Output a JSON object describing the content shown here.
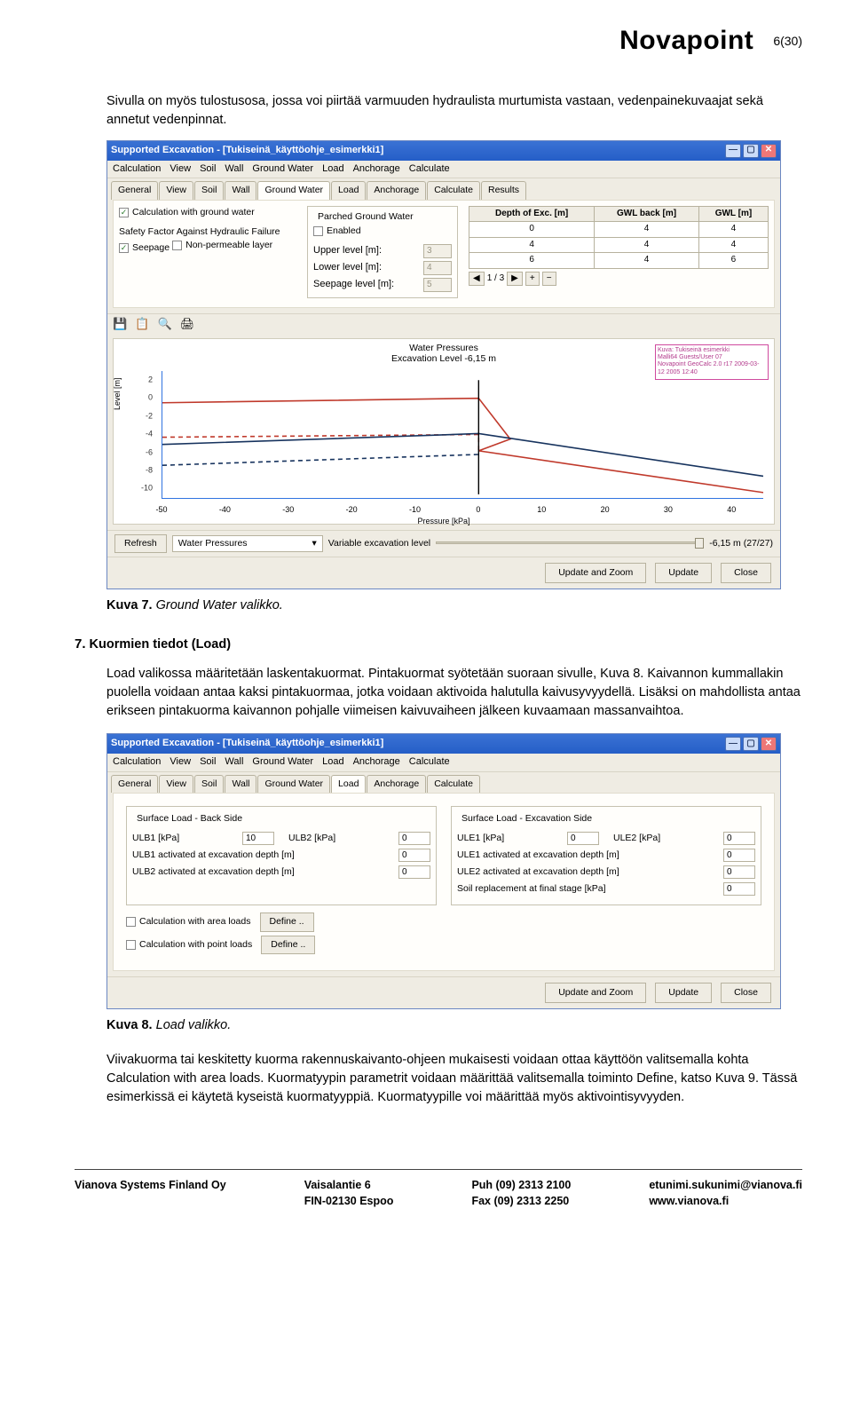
{
  "page_num": "6(30)",
  "logo": "Novapoint",
  "intro": "Sivulla on myös tulostusosa, jossa voi piirtää varmuuden hydraulista murtumista vastaan, vedenpainekuvaajat sekä annetut vedenpinnat.",
  "caption7_b": "Kuva 7.",
  "caption7_i": "Ground Water valikko.",
  "section_num": "7.",
  "section_title": "Kuormien tiedot (Load)",
  "section_body": "Load valikossa määritetään laskentakuormat. Pintakuormat syötetään suoraan sivulle, Kuva 8. Kaivannon kummallakin puolella voidaan antaa kaksi pintakuormaa, jotka voidaan aktivoida halutulla kaivusyvyydellä. Lisäksi on mahdollista antaa erikseen pintakuorma kaivannon pohjalle viimeisen kaivuvaiheen jälkeen kuvaamaan massanvaihtoa.",
  "caption8_b": "Kuva 8.",
  "caption8_i": "Load valikko.",
  "outro": "Viivakuorma tai keskitetty kuorma rakennuskaivanto-ohjeen mukaisesti voidaan ottaa käyttöön valitsemalla kohta Calculation with area loads. Kuormatyypin parametrit voidaan määrittää valitsemalla toiminto Define, katso Kuva 9. Tässä esimerkissä ei käytetä kyseistä kuormatyyppiä. Kuormatyypille voi määrittää myös aktivointisyvyyden.",
  "app1": {
    "title": "Supported Excavation - [Tukiseinä_käyttöohje_esimerkki1]",
    "menus": [
      "Calculation",
      "View",
      "Soil",
      "Wall",
      "Ground Water",
      "Load",
      "Anchorage",
      "Calculate"
    ],
    "tabs": [
      "General",
      "View",
      "Soil",
      "Wall",
      "Ground Water",
      "Load",
      "Anchorage",
      "Calculate",
      "Results"
    ],
    "left": {
      "calc_gw": "Calculation with ground water",
      "sf_label": "Safety Factor Against Hydraulic Failure",
      "seepage": "Seepage",
      "nonperm": "Non-permeable layer"
    },
    "mid": {
      "group": "Parched Ground Water",
      "enabled": "Enabled",
      "upper": "Upper level [m]:",
      "upper_v": "3",
      "lower": "Lower level [m]:",
      "lower_v": "4",
      "seep": "Seepage level [m]:",
      "seep_v": "5"
    },
    "grid": {
      "h1": "Depth of Exc. [m]",
      "h2": "GWL back [m]",
      "h3": "GWL [m]",
      "r": [
        [
          "0",
          "4",
          "4"
        ],
        [
          "4",
          "4",
          "4"
        ],
        [
          "6",
          "4",
          "6"
        ]
      ],
      "pager": "1 / 3"
    },
    "chart_title1": "Water Pressures",
    "chart_title2": "Excavation Level -6,15 m",
    "box": [
      "Kuva: Tukiseinä esimerkki",
      "Malli64 Guests/User 07",
      "Novapoint GeoCalc 2.0 r17 2009-03-12 2005 12:40"
    ],
    "refresh": "Refresh",
    "dropdown": "Water Pressures",
    "varlabel": "Variable excavation level",
    "slider_val": "-6,15 m (27/27)",
    "updzoom": "Update and Zoom",
    "update": "Update",
    "close": "Close"
  },
  "app2": {
    "title": "Supported Excavation - [Tukiseinä_käyttöohje_esimerkki1]",
    "menus": [
      "Calculation",
      "View",
      "Soil",
      "Wall",
      "Ground Water",
      "Load",
      "Anchorage",
      "Calculate"
    ],
    "tabs": [
      "General",
      "View",
      "Soil",
      "Wall",
      "Ground Water",
      "Load",
      "Anchorage",
      "Calculate"
    ],
    "back": {
      "title": "Surface Load - Back Side",
      "ulb1": "ULB1 [kPa]",
      "ulb1_v": "10",
      "ulb2": "ULB2 [kPa]",
      "ulb2_v": "0",
      "ulb1d": "ULB1 activated at excavation depth [m]",
      "ulb1d_v": "0",
      "ulb2d": "ULB2 activated at excavation depth [m]",
      "ulb2d_v": "0"
    },
    "exc": {
      "title": "Surface Load - Excavation Side",
      "ule1": "ULE1 [kPa]",
      "ule1_v": "0",
      "ule2": "ULE2 [kPa]",
      "ule2_v": "0",
      "ule1d": "ULE1 activated at excavation depth [m]",
      "ule1d_v": "0",
      "ule2d": "ULE2 activated at excavation depth [m]",
      "ule2d_v": "0",
      "soil": "Soil replacement at final stage [kPa]",
      "soil_v": "0"
    },
    "area": "Calculation with area loads",
    "point": "Calculation with point loads",
    "def": "Define ..",
    "updzoom": "Update and Zoom",
    "update": "Update",
    "close": "Close"
  },
  "footer": {
    "c1a": "Vianova Systems Finland Oy",
    "c2a": "Vaisalantie 6",
    "c2b": "FIN-02130 Espoo",
    "c3a": "Puh   (09) 2313 2100",
    "c3b": "Fax   (09) 2313 2250",
    "c4a": "etunimi.sukunimi@vianova.fi",
    "c4b": "www.vianova.fi"
  },
  "chart_data": {
    "type": "line",
    "title": "Water Pressures — Excavation Level -6,15 m",
    "xlabel": "Pressure [kPa]",
    "ylabel": "Level [m]",
    "xlim": [
      -50,
      45
    ],
    "ylim": [
      -11,
      3
    ],
    "xticks": [
      -50,
      -40,
      -30,
      -20,
      -10,
      0,
      10,
      20,
      30,
      40
    ],
    "yticks": [
      -10,
      -8,
      -6,
      -4,
      -2,
      0,
      2
    ],
    "series": [
      {
        "name": "series-red-top",
        "color": "#c0392b",
        "points": [
          [
            -50,
            -0.5
          ],
          [
            0,
            0
          ],
          [
            5,
            -4.5
          ],
          [
            0,
            -5.8
          ],
          [
            45,
            -10.4
          ]
        ]
      },
      {
        "name": "series-red-dash",
        "color": "#c0392b",
        "dash": true,
        "points": [
          [
            -50,
            -4.3
          ],
          [
            0,
            -4.0
          ],
          [
            0,
            -5.9
          ]
        ]
      },
      {
        "name": "series-blue",
        "color": "#17335e",
        "points": [
          [
            -50,
            -5.1
          ],
          [
            0,
            -3.9
          ],
          [
            45,
            -8.6
          ]
        ]
      },
      {
        "name": "series-blue-dash",
        "color": "#17335e",
        "dash": true,
        "points": [
          [
            -50,
            -7.4
          ],
          [
            0,
            -6.2
          ]
        ]
      },
      {
        "name": "axis-vert",
        "color": "#000",
        "points": [
          [
            0,
            2
          ],
          [
            0,
            -10.6
          ]
        ]
      }
    ]
  }
}
